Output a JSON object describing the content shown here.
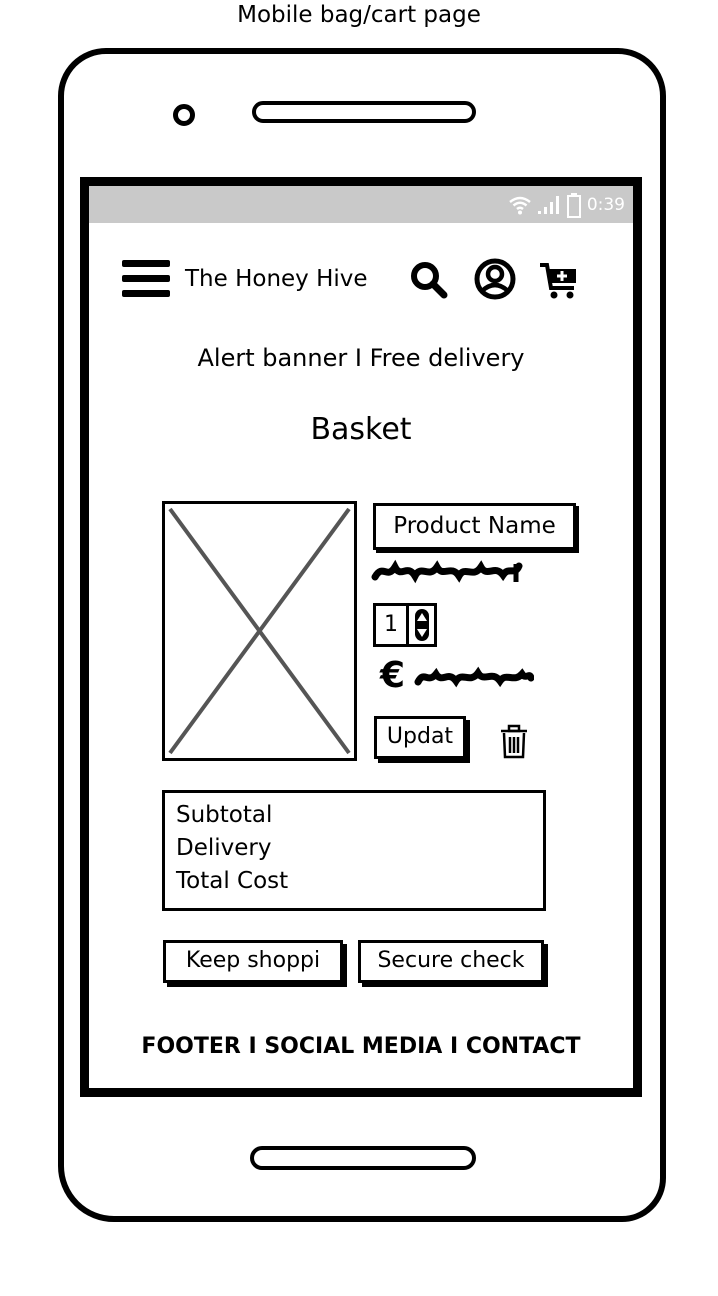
{
  "caption": "Mobile bag/cart page",
  "status_bar": {
    "time": "0:39",
    "icons": [
      "wifi-icon",
      "signal-icon",
      "battery-icon"
    ]
  },
  "header": {
    "brand": "The Honey Hive",
    "icons": [
      "hamburger-menu-icon",
      "search-icon",
      "account-icon",
      "cart-plus-icon"
    ]
  },
  "alert_banner": "Alert banner I Free delivery",
  "page_title": "Basket",
  "product": {
    "image_placeholder": "image-placeholder",
    "name": "Product Name",
    "quantity": "1",
    "price_symbol": "€",
    "update_label": "Updat"
  },
  "summary": {
    "subtotal_label": "Subtotal",
    "delivery_label": "Delivery",
    "total_label": "Total Cost"
  },
  "buttons": {
    "keep_shopping": "Keep shoppi",
    "secure_checkout": "Secure check"
  },
  "footer": "FOOTER I SOCIAL MEDIA I CONTACT"
}
